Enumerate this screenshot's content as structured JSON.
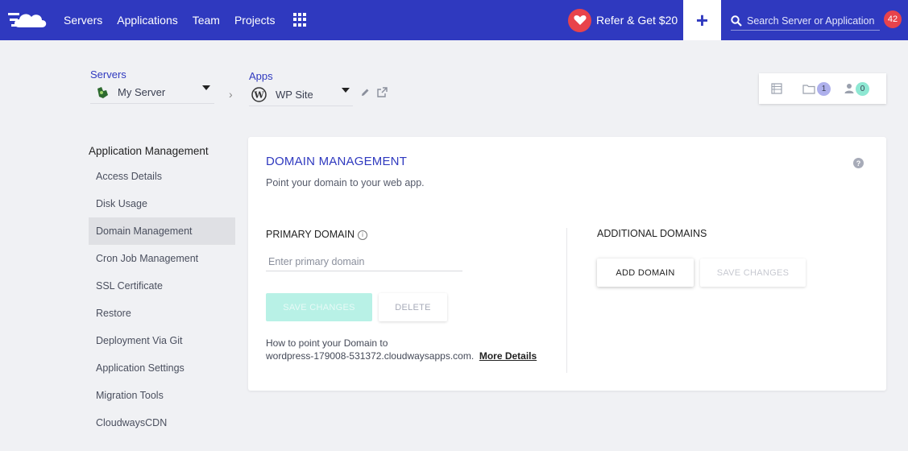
{
  "topbar": {
    "nav": [
      "Servers",
      "Applications",
      "Team",
      "Projects"
    ],
    "refer_label": "Refer & Get $20",
    "plus_label": "+",
    "search_placeholder": "Search Server or Application",
    "notifications_count": "42"
  },
  "breadcrumb": {
    "servers_label": "Servers",
    "server_value": "My Server",
    "apps_label": "Apps",
    "app_value": "WP Site"
  },
  "quick_panel": {
    "folder_count": "1",
    "users_count": "0"
  },
  "sidebar": {
    "title": "Application Management",
    "items": [
      "Access Details",
      "Disk Usage",
      "Domain Management",
      "Cron Job Management",
      "SSL Certificate",
      "Restore",
      "Deployment Via Git",
      "Application Settings",
      "Migration Tools",
      "CloudwaysCDN"
    ],
    "active_index": 2
  },
  "card": {
    "title": "DOMAIN MANAGEMENT",
    "subtitle": "Point your domain to your web app.",
    "primary_label": "PRIMARY DOMAIN",
    "primary_placeholder": "Enter primary domain",
    "save_changes_label": "SAVE CHANGES",
    "delete_label": "DELETE",
    "howto_line1": "How to point your Domain to",
    "howto_domain": "wordpress-179008-531372.cloudwaysapps.com.",
    "more_details": "More Details",
    "additional_label": "ADDITIONAL DOMAINS",
    "add_domain_label": "ADD DOMAIN",
    "save_changes_label_2": "SAVE CHANGES",
    "help_symbol": "?"
  },
  "colors": {
    "brand": "#2f39bf",
    "alert": "#e8434b",
    "teal": "#b8f1e6",
    "badge_purple": "#aeb0ec",
    "badge_teal": "#8ee8d3"
  }
}
